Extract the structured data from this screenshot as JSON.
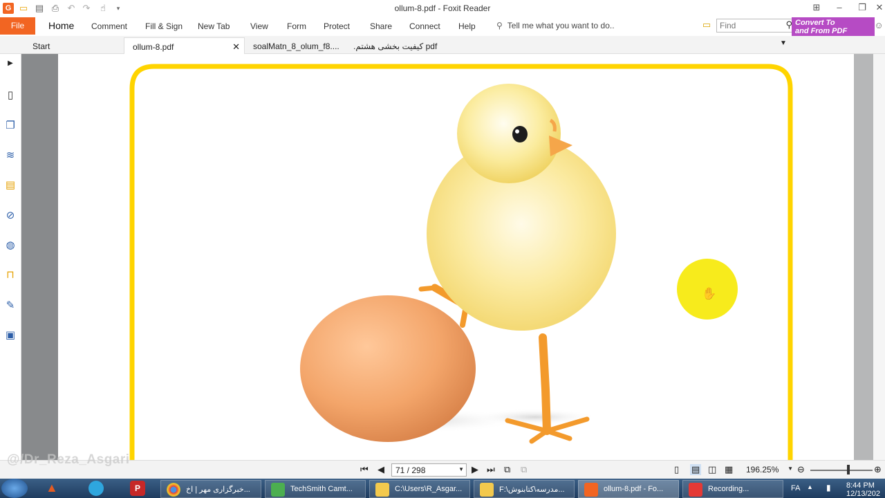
{
  "window": {
    "title": "ollum-8.pdf - Foxit Reader"
  },
  "ribbon": {
    "file_label": "File",
    "tabs": [
      "Home",
      "Comment",
      "Fill & Sign",
      "New Tab",
      "View",
      "Form",
      "Protect",
      "Share",
      "Connect",
      "Help"
    ],
    "tell_me": "Tell me what you want to do..",
    "find_placeholder": "Find",
    "convert_line1": "Convert To",
    "convert_line2": "and From PDF"
  },
  "doc_tabs": [
    {
      "label": "Start"
    },
    {
      "label": "ollum-8.pdf"
    },
    {
      "label": "soalMatn_8_olum_f8...."
    },
    {
      "label": ".کیفیت بخشی هشتم pdf"
    }
  ],
  "left_panel_icons": [
    "bookmark-icon",
    "pages-icon",
    "layers-icon",
    "comments-icon",
    "attachment-icon",
    "signature-icon",
    "security-icon",
    "tools-icon",
    "properties-icon"
  ],
  "status": {
    "page_nav": "71 / 298",
    "zoom": "196.25%"
  },
  "watermark": "@/Dr_Reza_Asgari",
  "taskbar": {
    "items": [
      "خبرگزاری مهر | اخ...",
      "TechSmith Camt...",
      "C:\\Users\\R_Asgar...",
      "F:\\مدرسه\\کتابنوش...",
      "ollum-8.pdf - Fo...",
      "Recording..."
    ],
    "lang": "FA",
    "time": "8:44 PM",
    "date": "12/13/202"
  },
  "colors": {
    "file_tab": "#f26522",
    "frame": "#ffd400",
    "convert": "#b64bc4"
  }
}
